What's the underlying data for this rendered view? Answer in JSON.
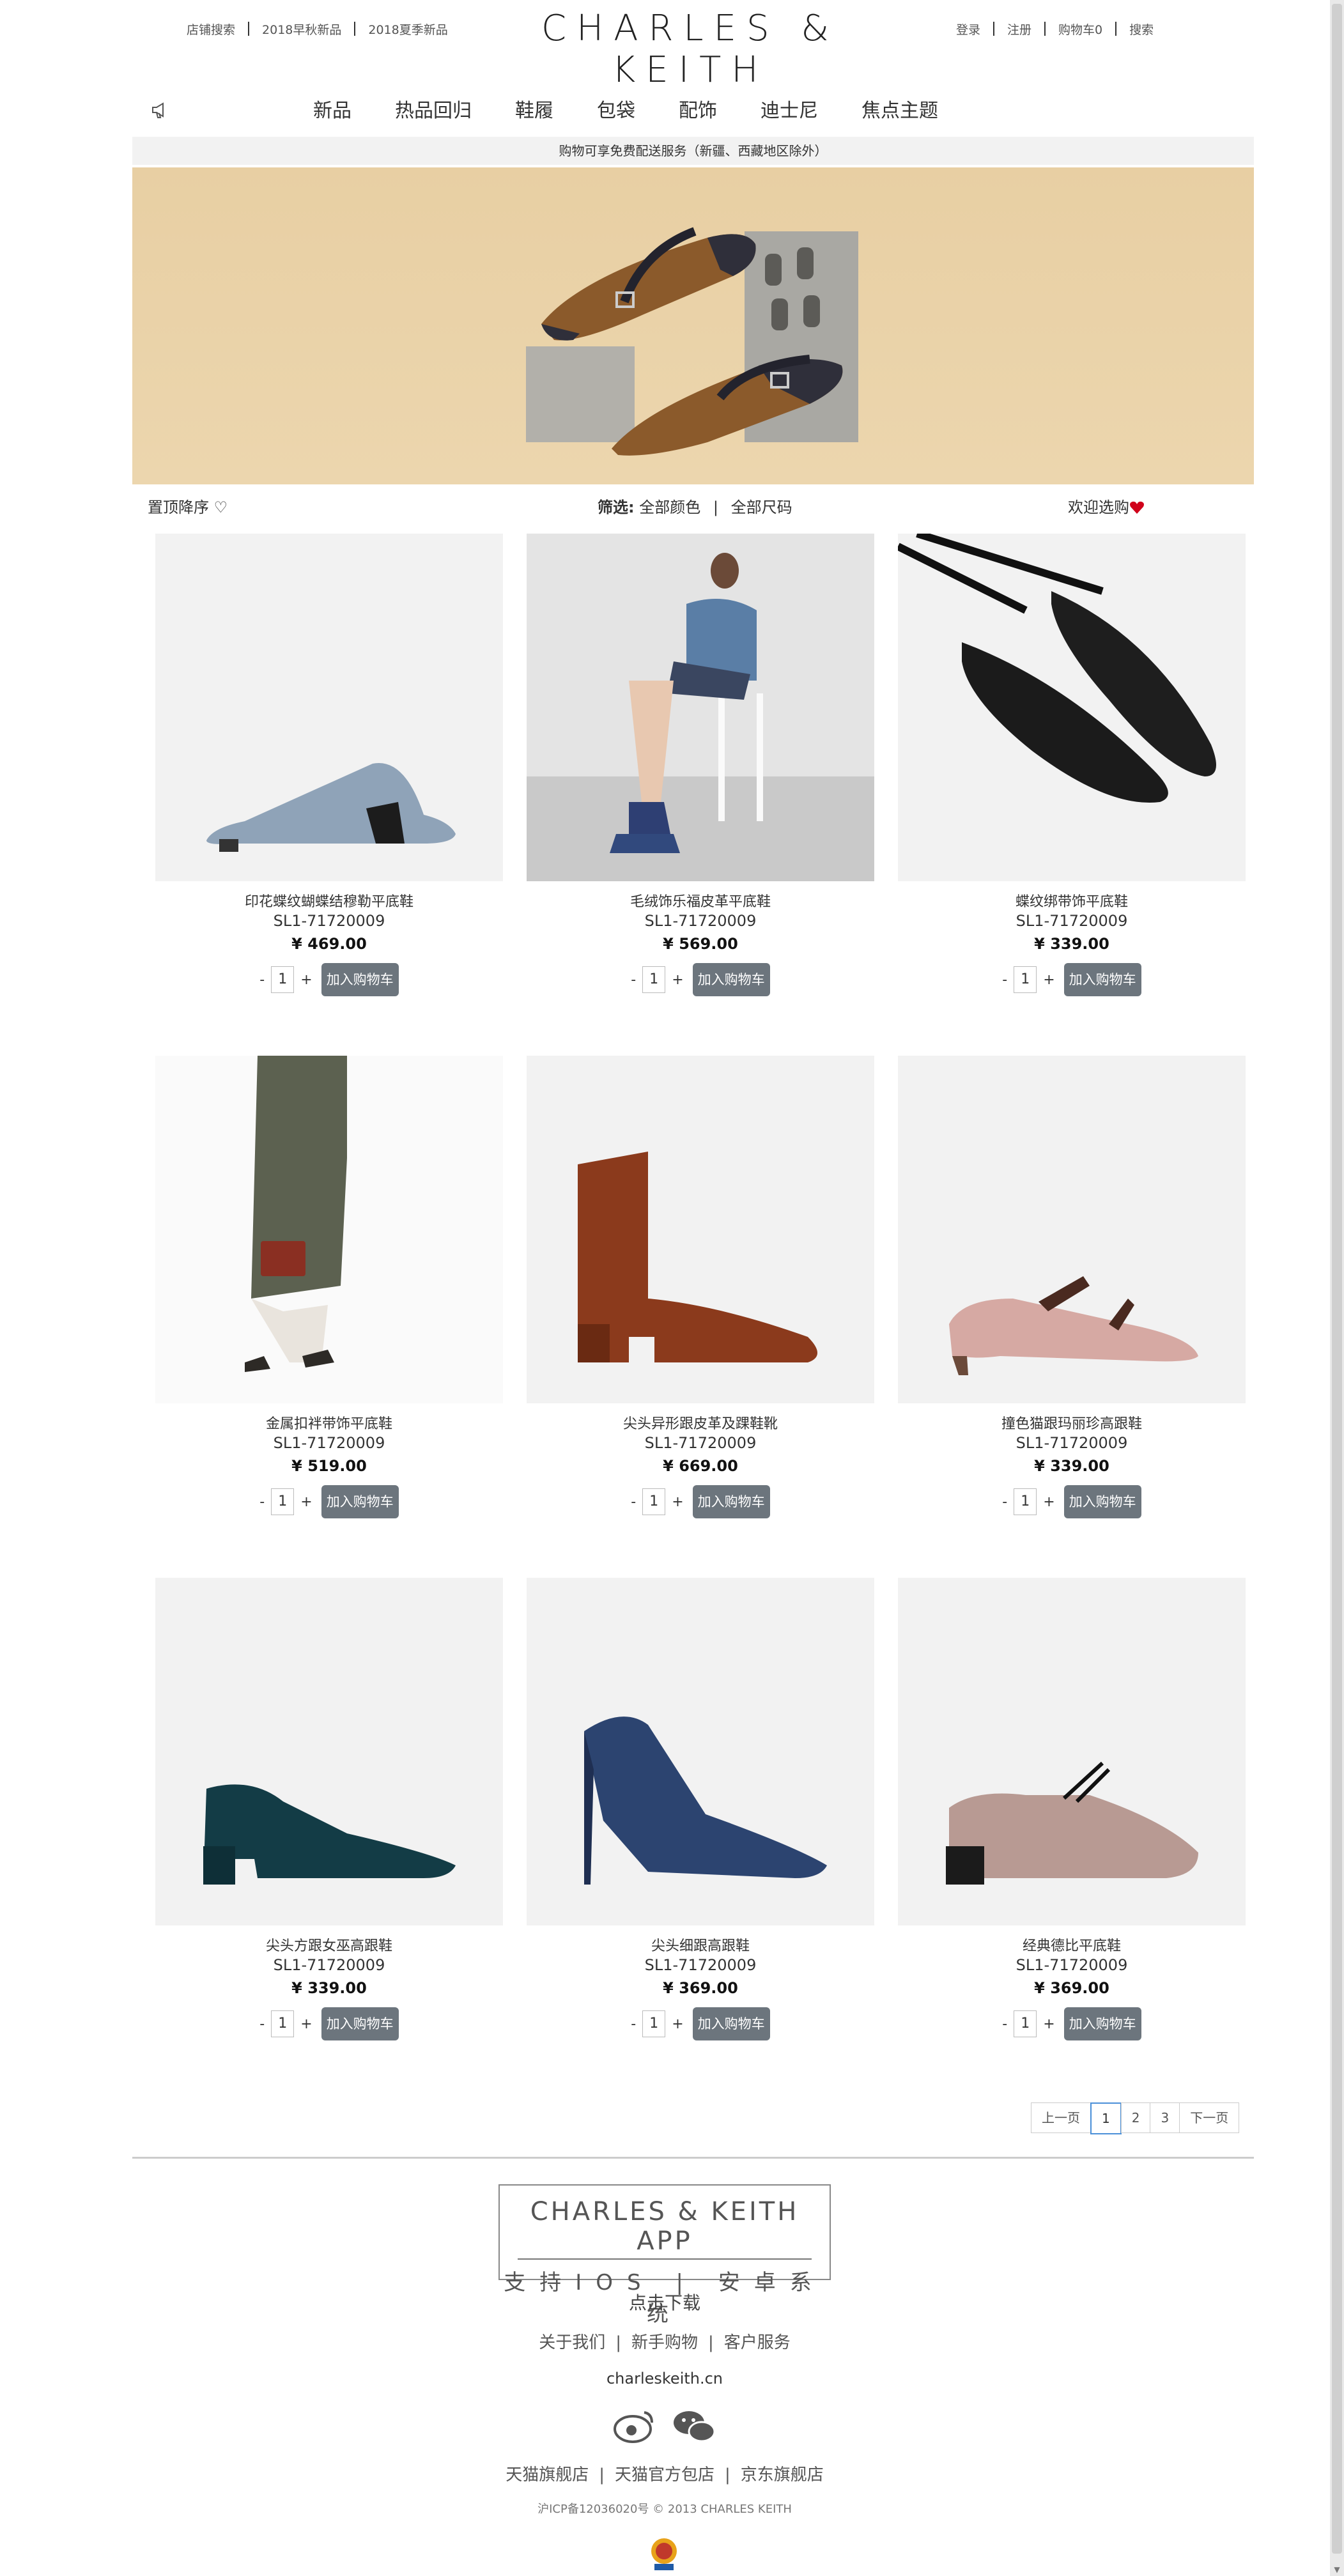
{
  "header": {
    "left_links": [
      "店铺搜索",
      "2018早秋新品",
      "2018夏季新品"
    ],
    "logo": "CHARLES & KEITH",
    "right_links": [
      "登录",
      "注册",
      "购物车0",
      "搜索"
    ]
  },
  "nav": {
    "items": [
      "新品",
      "热品回归",
      "鞋履",
      "包袋",
      "配饰",
      "迪士尼",
      "焦点主题"
    ],
    "menu_icon": "megaphone-icon"
  },
  "notice": "购物可享免费配送服务（新疆、西藏地区除外）",
  "filterbar": {
    "sort": "置顶降序 ♡",
    "filter_label": "筛选:",
    "filter_color": "全部颜色",
    "filter_sep": "|",
    "filter_size": "全部尺码",
    "welcome": "欢迎选购"
  },
  "products": [
    {
      "name": "印花蝶纹蝴蝶结穆勒平底鞋",
      "sku": "SL1-71720009",
      "price": "¥ 469.00",
      "qty": "1",
      "minus": "-",
      "plus": "+",
      "add": "加入购物车"
    },
    {
      "name": "毛绒饰乐福皮革平底鞋",
      "sku": "SL1-71720009",
      "price": "¥ 569.00",
      "qty": "1",
      "minus": "-",
      "plus": "+",
      "add": "加入购物车"
    },
    {
      "name": "蝶纹绑带饰平底鞋",
      "sku": "SL1-71720009",
      "price": "¥ 339.00",
      "qty": "1",
      "minus": "-",
      "plus": "+",
      "add": "加入购物车"
    },
    {
      "name": "金属扣袢带饰平底鞋",
      "sku": "SL1-71720009",
      "price": "¥ 519.00",
      "qty": "1",
      "minus": "-",
      "plus": "+",
      "add": "加入购物车"
    },
    {
      "name": "尖头异形跟皮革及踝鞋靴",
      "sku": "SL1-71720009",
      "price": "¥ 669.00",
      "qty": "1",
      "minus": "-",
      "plus": "+",
      "add": "加入购物车"
    },
    {
      "name": "撞色猫跟玛丽珍高跟鞋",
      "sku": "SL1-71720009",
      "price": "¥ 339.00",
      "qty": "1",
      "minus": "-",
      "plus": "+",
      "add": "加入购物车"
    },
    {
      "name": "尖头方跟女巫高跟鞋",
      "sku": "SL1-71720009",
      "price": "¥ 339.00",
      "qty": "1",
      "minus": "-",
      "plus": "+",
      "add": "加入购物车"
    },
    {
      "name": "尖头细跟高跟鞋",
      "sku": "SL1-71720009",
      "price": "¥ 369.00",
      "qty": "1",
      "minus": "-",
      "plus": "+",
      "add": "加入购物车"
    },
    {
      "name": "经典德比平底鞋",
      "sku": "SL1-71720009",
      "price": "¥ 369.00",
      "qty": "1",
      "minus": "-",
      "plus": "+",
      "add": "加入购物车"
    }
  ],
  "pager": {
    "prev": "上一页",
    "pages": [
      "1",
      "2",
      "3"
    ],
    "next": "下一页",
    "current": "1"
  },
  "footer": {
    "app_title": "CHARLES & KEITH APP",
    "app_sub": "支持IOS | 安卓系统",
    "download": "点击下载",
    "links": [
      "关于我们",
      "新手购物",
      "客户服务"
    ],
    "site": "charleskeith.cn",
    "social_icons": [
      "weibo-icon",
      "wechat-icon"
    ],
    "shops": [
      "天猫旗舰店",
      "天猫官方包店",
      "京东旗舰店"
    ],
    "copyright": "沪ICP备12036020号 © 2013 CHARLES KEITH"
  },
  "colors": {
    "button": "#6c757d",
    "notice_bg": "#f2f2f2",
    "banner_bg": "#ecd6ae",
    "pager_active": "#4a8fd8",
    "heart": "#d0021b"
  }
}
